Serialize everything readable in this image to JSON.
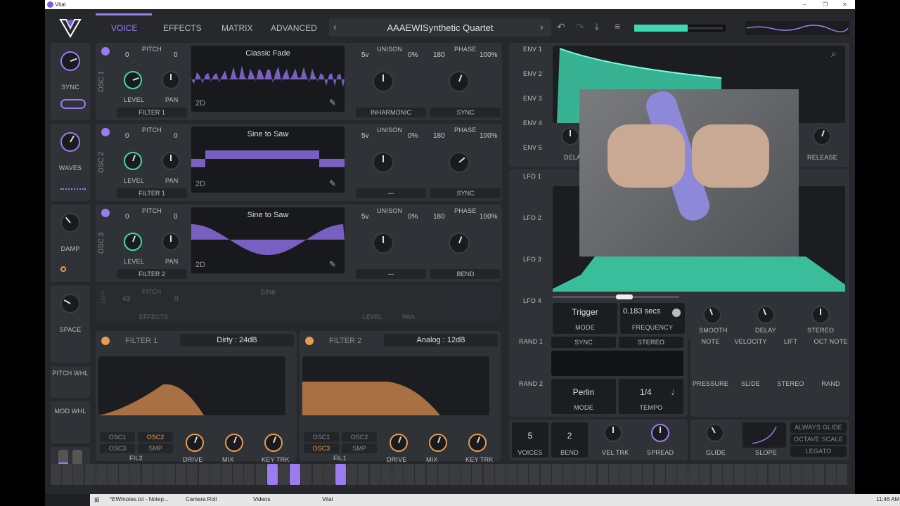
{
  "titlebar": {
    "title": "Vital",
    "minimize": "–",
    "maximize": "❐",
    "close": "✕"
  },
  "tabs": [
    "VOICE",
    "EFFECTS",
    "MATRIX",
    "ADVANCED"
  ],
  "preset": {
    "name": "AAAEWISynthetic Quartet",
    "prev": "‹",
    "next": "›"
  },
  "macros": [
    {
      "label": "SYNC"
    },
    {
      "label": "WAVES"
    },
    {
      "label": "DAMP"
    },
    {
      "label": "SPACE"
    }
  ],
  "side_labels": {
    "pitch_wheel": "PITCH WHL",
    "mod_wheel": "MOD WHL"
  },
  "oscillators": [
    {
      "section": "OSC 1",
      "pitch_left": "0",
      "pitch_label": "PITCH",
      "pitch_right": "0",
      "wave": "Classic Fade",
      "mode": "2D",
      "level": "LEVEL",
      "pan": "PAN",
      "filter": "FILTER 1",
      "unison_label": "UNISON",
      "voices": "5v",
      "detune": "0%",
      "phase_label": "PHASE",
      "phase": "180",
      "phase_pct": "100%",
      "spectral": "INHARMONIC",
      "distortion": "SYNC"
    },
    {
      "section": "OSC 2",
      "pitch_left": "0",
      "pitch_label": "PITCH",
      "pitch_right": "0",
      "wave": "Sine to Saw",
      "mode": "2D",
      "level": "LEVEL",
      "pan": "PAN",
      "filter": "FILTER 1",
      "unison_label": "UNISON",
      "voices": "5v",
      "detune": "0%",
      "phase_label": "PHASE",
      "phase": "180",
      "phase_pct": "100%",
      "spectral": "---",
      "distortion": "SYNC"
    },
    {
      "section": "OSC 3",
      "pitch_left": "0",
      "pitch_label": "PITCH",
      "pitch_right": "0",
      "wave": "Sine to Saw",
      "mode": "2D",
      "level": "LEVEL",
      "pan": "PAN",
      "filter": "FILTER 2",
      "unison_label": "UNISON",
      "voices": "5v",
      "detune": "0%",
      "phase_label": "PHASE",
      "phase": "180",
      "phase_pct": "100%",
      "spectral": "---",
      "distortion": "BEND"
    }
  ],
  "sampler": {
    "section": "SMP",
    "pitch_left": "43",
    "pitch_label": "PITCH",
    "pitch_right": "0",
    "wave": "Sine",
    "level": "LEVEL",
    "pan": "PAN",
    "effects": "EFFECTS"
  },
  "filters": [
    {
      "title": "FILTER 1",
      "model": "Dirty : 24dB",
      "routes": [
        "OSC1",
        "OSC2",
        "OSC3",
        "SMP"
      ],
      "fil": "FIL2",
      "drive": "DRIVE",
      "mix": "MIX",
      "keytrk": "KEY TRK"
    },
    {
      "title": "FILTER 2",
      "model": "Analog : 12dB",
      "routes": [
        "OSC1",
        "OSC2",
        "OSC3",
        "SMP"
      ],
      "fil": "FIL1",
      "drive": "DRIVE",
      "mix": "MIX",
      "keytrk": "KEY TRK"
    }
  ],
  "envelopes": [
    "ENV 1",
    "ENV 2",
    "ENV 3",
    "ENV 4",
    "ENV 5"
  ],
  "env_knobs": {
    "delay": "DELA",
    "release": "RELEASE"
  },
  "lfos": [
    "LFO 1",
    "LFO 2",
    "LFO 3",
    "LFO 4"
  ],
  "lfo_controls": {
    "mode_value": "Trigger",
    "mode_label": "MODE",
    "freq_value": "0.183 secs",
    "freq_label": "FREQUENCY",
    "smooth": "SMOOTH",
    "delay": "DELAY",
    "stereo": "STEREO"
  },
  "randoms": [
    "RAND 1",
    "RAND 2"
  ],
  "rand_controls": {
    "sync": "SYNC",
    "stereo": "STEREO",
    "style": "Perlin",
    "mode": "MODE",
    "tempo": "1/4",
    "tempo_label": "TEMPO"
  },
  "mod_sources": [
    "NOTE",
    "VELOCITY",
    "LIFT",
    "OCT NOTE",
    "PRESSURE",
    "SLIDE",
    "STEREO",
    "RAND"
  ],
  "voice": {
    "voices": "5",
    "voices_label": "VOICES",
    "bend": "2",
    "bend_label": "BEND",
    "veltrk": "VEL TRK",
    "spread": "SPREAD",
    "glide": "GLIDE",
    "slope": "SLOPE",
    "always_glide": "ALWAYS GLIDE",
    "octave_scale": "OCTAVE SCALE",
    "legato": "LEGATO"
  },
  "taskbar": {
    "items": [
      "*EWInotes.txt - Notep...",
      "Camera Roll",
      "Videos",
      "Vital"
    ],
    "time": "11:46 AM"
  },
  "colors": {
    "accent": "#9b7bf0",
    "env": "#3fd9b0",
    "filter": "#e89b4f",
    "bg": "#26282c"
  }
}
